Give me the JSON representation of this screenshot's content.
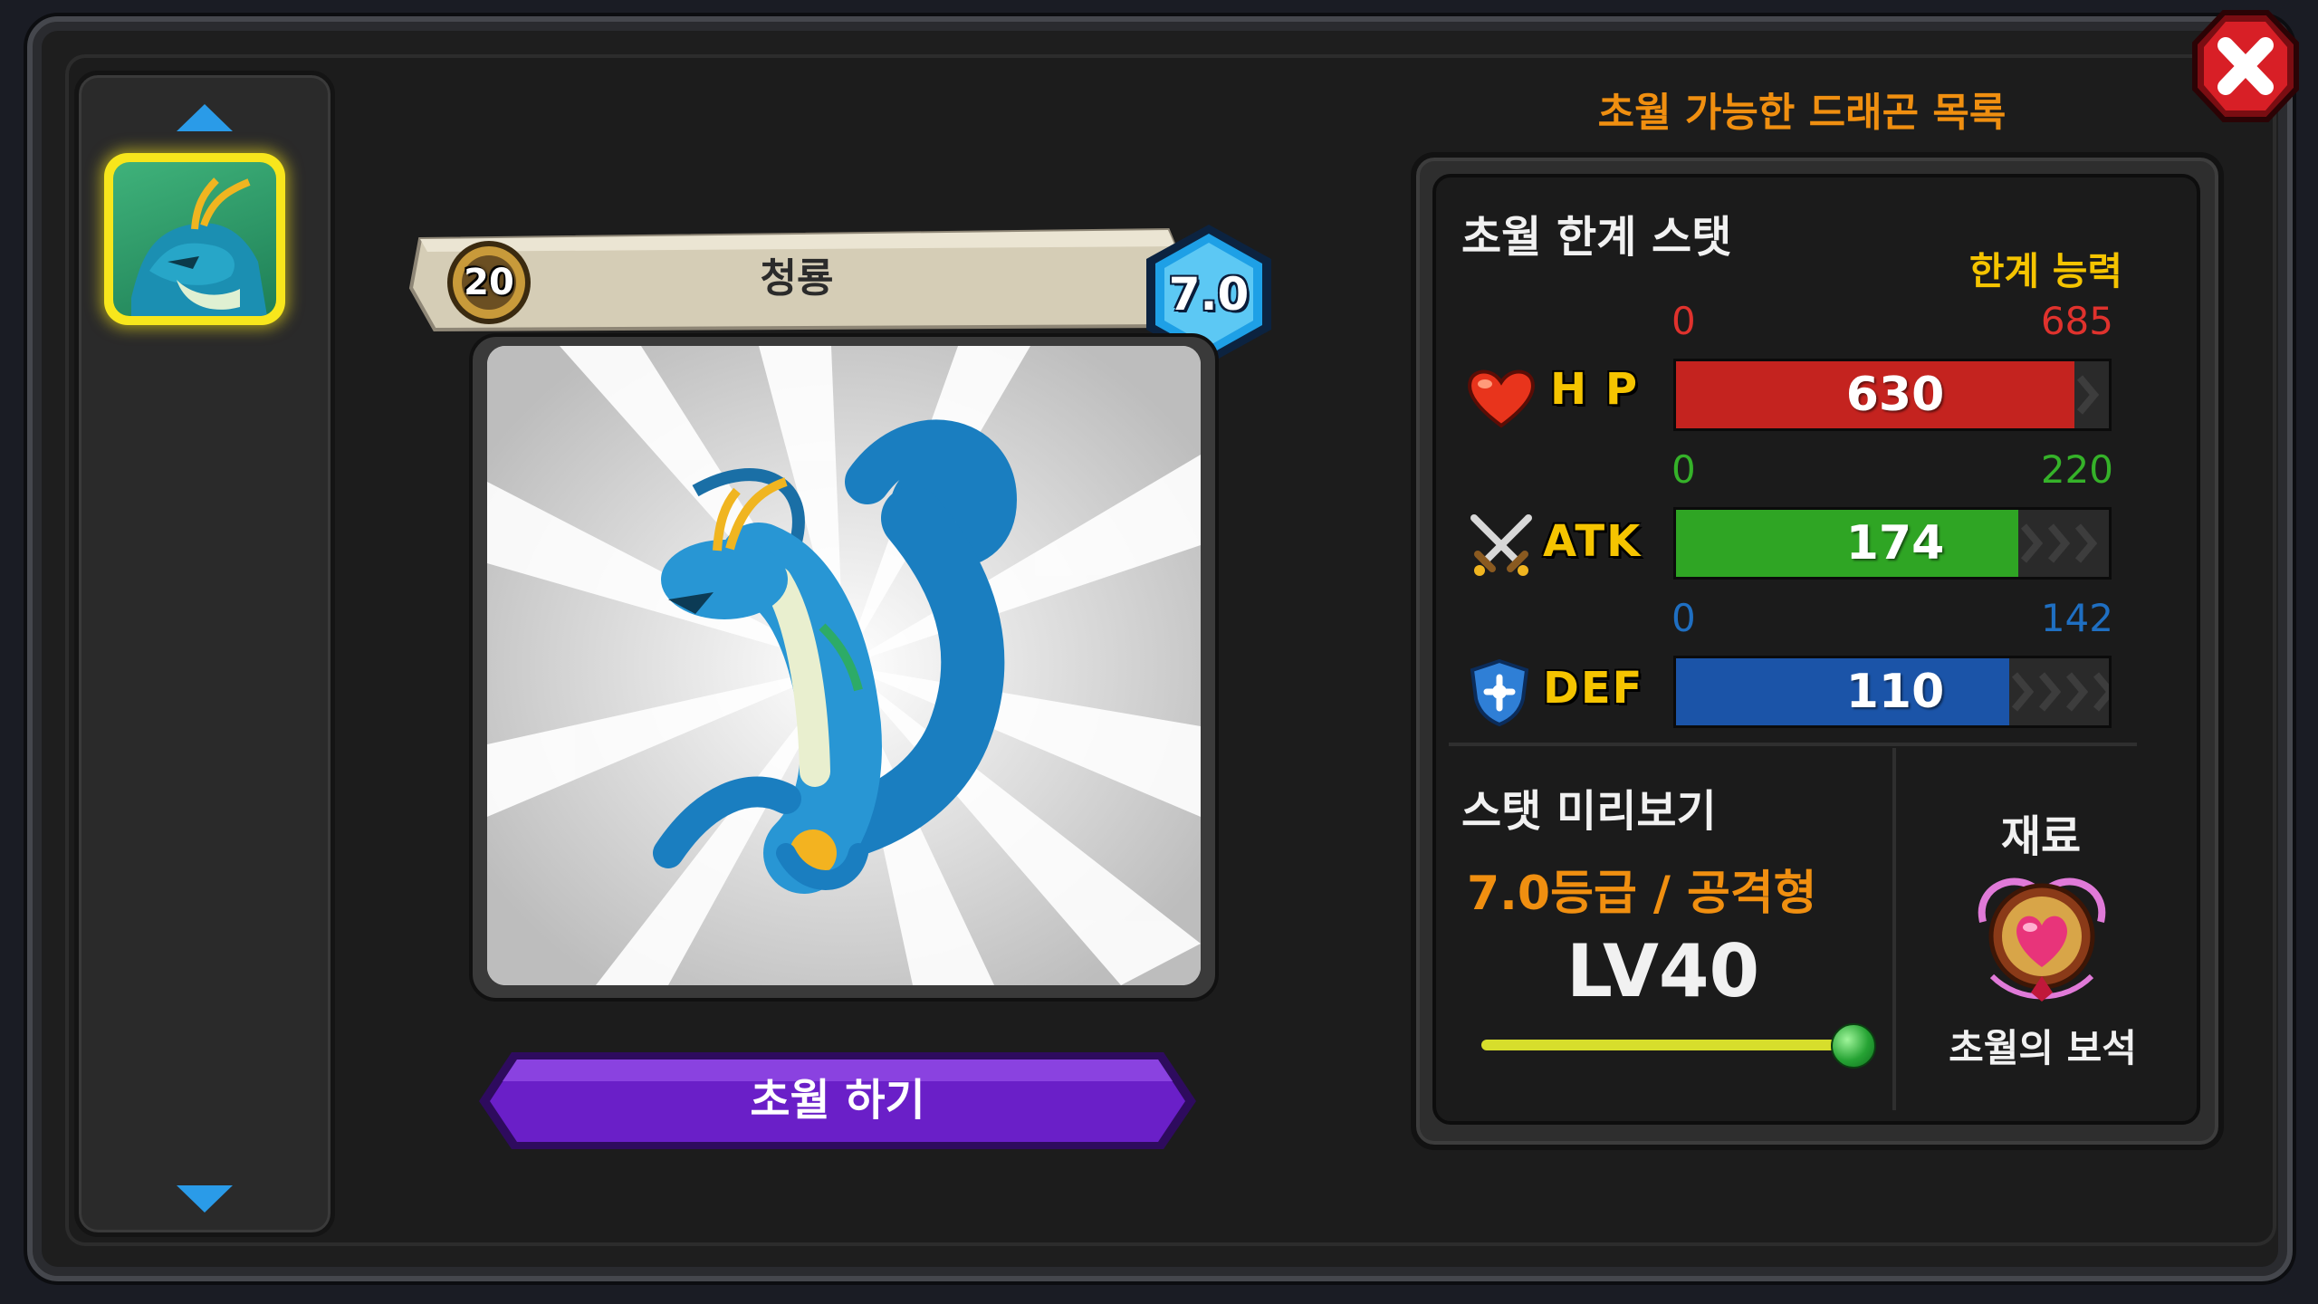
{
  "window": {
    "list_title": "초월 가능한 드래곤 목록",
    "close_label": "close"
  },
  "dragon": {
    "name": "청룡",
    "level": "20",
    "grade": "7.0"
  },
  "actions": {
    "transcend_label": "초월 하기"
  },
  "stats": {
    "section_title": "초월 한계 스탯",
    "limit_label": "한계 능력",
    "items": [
      {
        "key": "hp",
        "label": "H P",
        "min": "0",
        "max": "685",
        "value": "630",
        "fill_fraction": 0.92,
        "color": "#c4231f",
        "range_color": "#e0322d"
      },
      {
        "key": "atk",
        "label": "ATK",
        "min": "0",
        "max": "220",
        "value": "174",
        "fill_fraction": 0.79,
        "color": "#2fa524",
        "range_color": "#35b229"
      },
      {
        "key": "def",
        "label": "DEF",
        "min": "0",
        "max": "142",
        "value": "110",
        "fill_fraction": 0.77,
        "color": "#1b54a8",
        "range_color": "#1f6fc2"
      }
    ]
  },
  "preview": {
    "title": "스탯 미리보기",
    "grade_type": "7.0등급 / 공격형",
    "level": "LV40",
    "level_fraction": 1.0
  },
  "material": {
    "title": "재료",
    "name": "초월의 보석"
  },
  "colors": {
    "accent_orange": "#f08f10",
    "label_yellow": "#f5c400",
    "button_purple": "#6a1fc8"
  }
}
